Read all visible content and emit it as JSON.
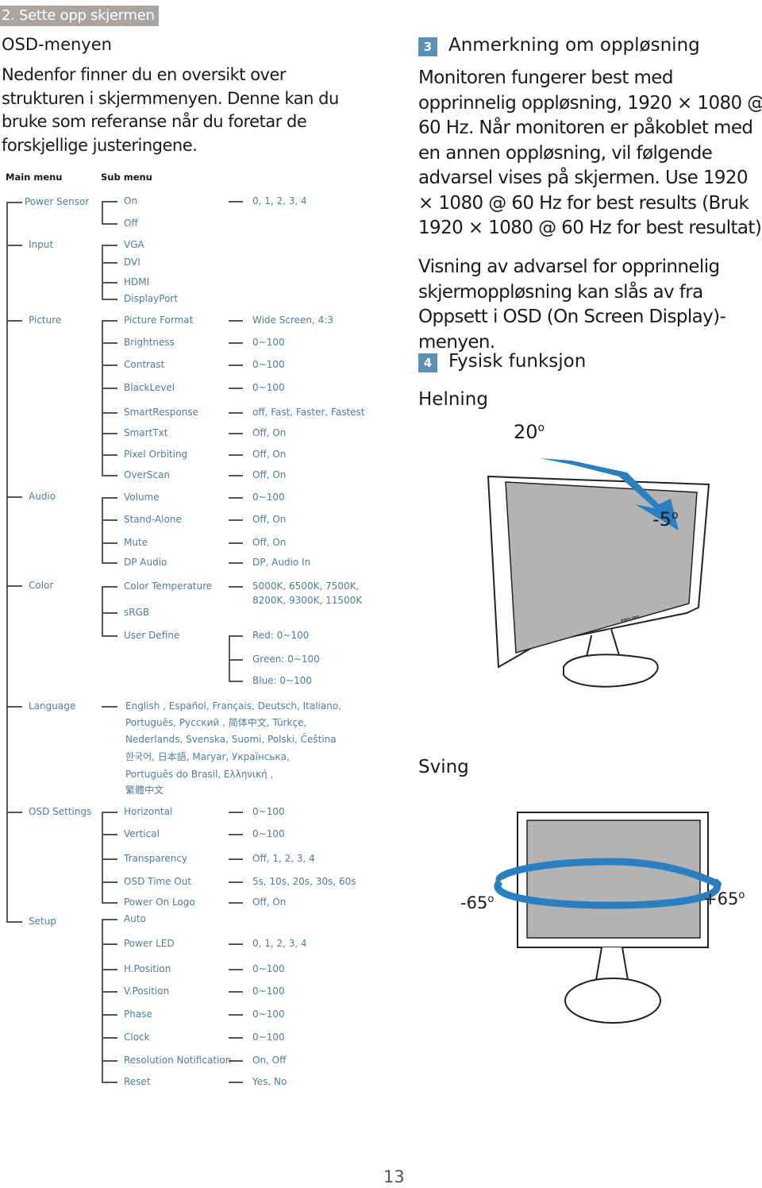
{
  "section_tag": "2. Sette opp skjermen",
  "title": "OSD-menyen",
  "intro": "Nedenfor finner du en oversikt over strukturen i skjermmenyen. Denne kan du bruke som referanse når du foretar de forskjellige justeringene.",
  "tree": {
    "main_header": "Main menu",
    "sub_header": "Sub menu",
    "menus": [
      {
        "label": "Power Sensor",
        "items": [
          {
            "label": "On",
            "value": "0, 1, 2, 3, 4"
          },
          {
            "label": "Off"
          }
        ]
      },
      {
        "label": "Input",
        "items": [
          {
            "label": "VGA"
          },
          {
            "label": "DVI"
          },
          {
            "label": "HDMI"
          },
          {
            "label": "DisplayPort"
          }
        ]
      },
      {
        "label": "Picture",
        "items": [
          {
            "label": "Picture Format",
            "value": "Wide Screen, 4:3"
          },
          {
            "label": "Brightness",
            "value": "0~100"
          },
          {
            "label": "Contrast",
            "value": "0~100"
          },
          {
            "label": "BlackLevel",
            "value": "0~100"
          },
          {
            "label": "SmartResponse",
            "value": "off, Fast, Faster, Fastest"
          },
          {
            "label": "SmartTxt",
            "value": "Off, On"
          },
          {
            "label": "Pixel Orbiting",
            "value": "Off, On"
          },
          {
            "label": "OverScan",
            "value": "Off, On"
          }
        ]
      },
      {
        "label": "Audio",
        "items": [
          {
            "label": "Volume",
            "value": "0~100"
          },
          {
            "label": "Stand-Alone",
            "value": "Off, On"
          },
          {
            "label": "Mute",
            "value": "Off, On"
          },
          {
            "label": "DP Audio",
            "value": "DP, Audio In"
          }
        ]
      },
      {
        "label": "Color",
        "items": [
          {
            "label": "Color Temperature",
            "value": "5000K, 6500K, 7500K,",
            "value2": "8200K, 9300K, 11500K"
          },
          {
            "label": "sRGB"
          },
          {
            "label": "User Define",
            "subvalues": [
              "Red: 0~100",
              "Green: 0~100",
              "Blue: 0~100"
            ]
          }
        ]
      },
      {
        "label": "Language",
        "languages": [
          "English , Español, Français, Deutsch, Italiano,",
          "Português, Русский , 简体中文, Türkçe,",
          "Nederlands, Svenska, Suomi, Polski, Čeština",
          "한국어, 日本語, Maryar, Українська,",
          "Português do Brasil, Ελληνική ,",
          "繁體中文"
        ]
      },
      {
        "label": "OSD Settings",
        "items": [
          {
            "label": "Horizontal",
            "value": "0~100"
          },
          {
            "label": "Vertical",
            "value": "0~100"
          },
          {
            "label": "Transparency",
            "value": "Off, 1, 2, 3, 4"
          },
          {
            "label": "OSD Time Out",
            "value": "5s, 10s, 20s, 30s, 60s"
          },
          {
            "label": "Power On Logo",
            "value": "Off, On"
          }
        ]
      },
      {
        "label": "Setup",
        "items": [
          {
            "label": "Auto"
          },
          {
            "label": "Power LED",
            "value": "0, 1, 2, 3, 4"
          },
          {
            "label": "H.Position",
            "value": "0~100"
          },
          {
            "label": "V.Position",
            "value": "0~100"
          },
          {
            "label": "Phase",
            "value": "0~100"
          },
          {
            "label": "Clock",
            "value": "0~100"
          },
          {
            "label": "Resolution Notification",
            "value": "On, Off"
          },
          {
            "label": "Reset",
            "value": "Yes, No"
          }
        ]
      }
    ]
  },
  "right": {
    "s3_num": "3",
    "s3_title": "Anmerkning om oppløsning",
    "s3_p1": "Monitoren fungerer best med opprinnelig oppløsning, 1920 × 1080 @ 60 Hz. Når monitoren er påkoblet med en annen oppløsning, vil følgende advarsel vises på skjermen. Use 1920 × 1080 @ 60 Hz for best results (Bruk 1920 × 1080 @ 60 Hz for best resultat).",
    "s3_p2": "Visning av advarsel for opprinnelig skjermoppløsning kan slås av fra Oppsett i OSD (On Screen Display)-menyen.",
    "s4_num": "4",
    "s4_title": "Fysisk funksjon",
    "tilt_title": "Helning",
    "tilt_up": "20",
    "tilt_down": "-5",
    "swivel_title": "Sving",
    "swivel_left": "-65",
    "swivel_right": "+65",
    "monitor_brand": "PHILIPS"
  },
  "colors": {
    "accent": "#5b8fb3",
    "tree_text": "#4f7d99",
    "tag_bg": "#a8a5a3",
    "arrow": "#2a7fc1"
  },
  "page_number": "13"
}
